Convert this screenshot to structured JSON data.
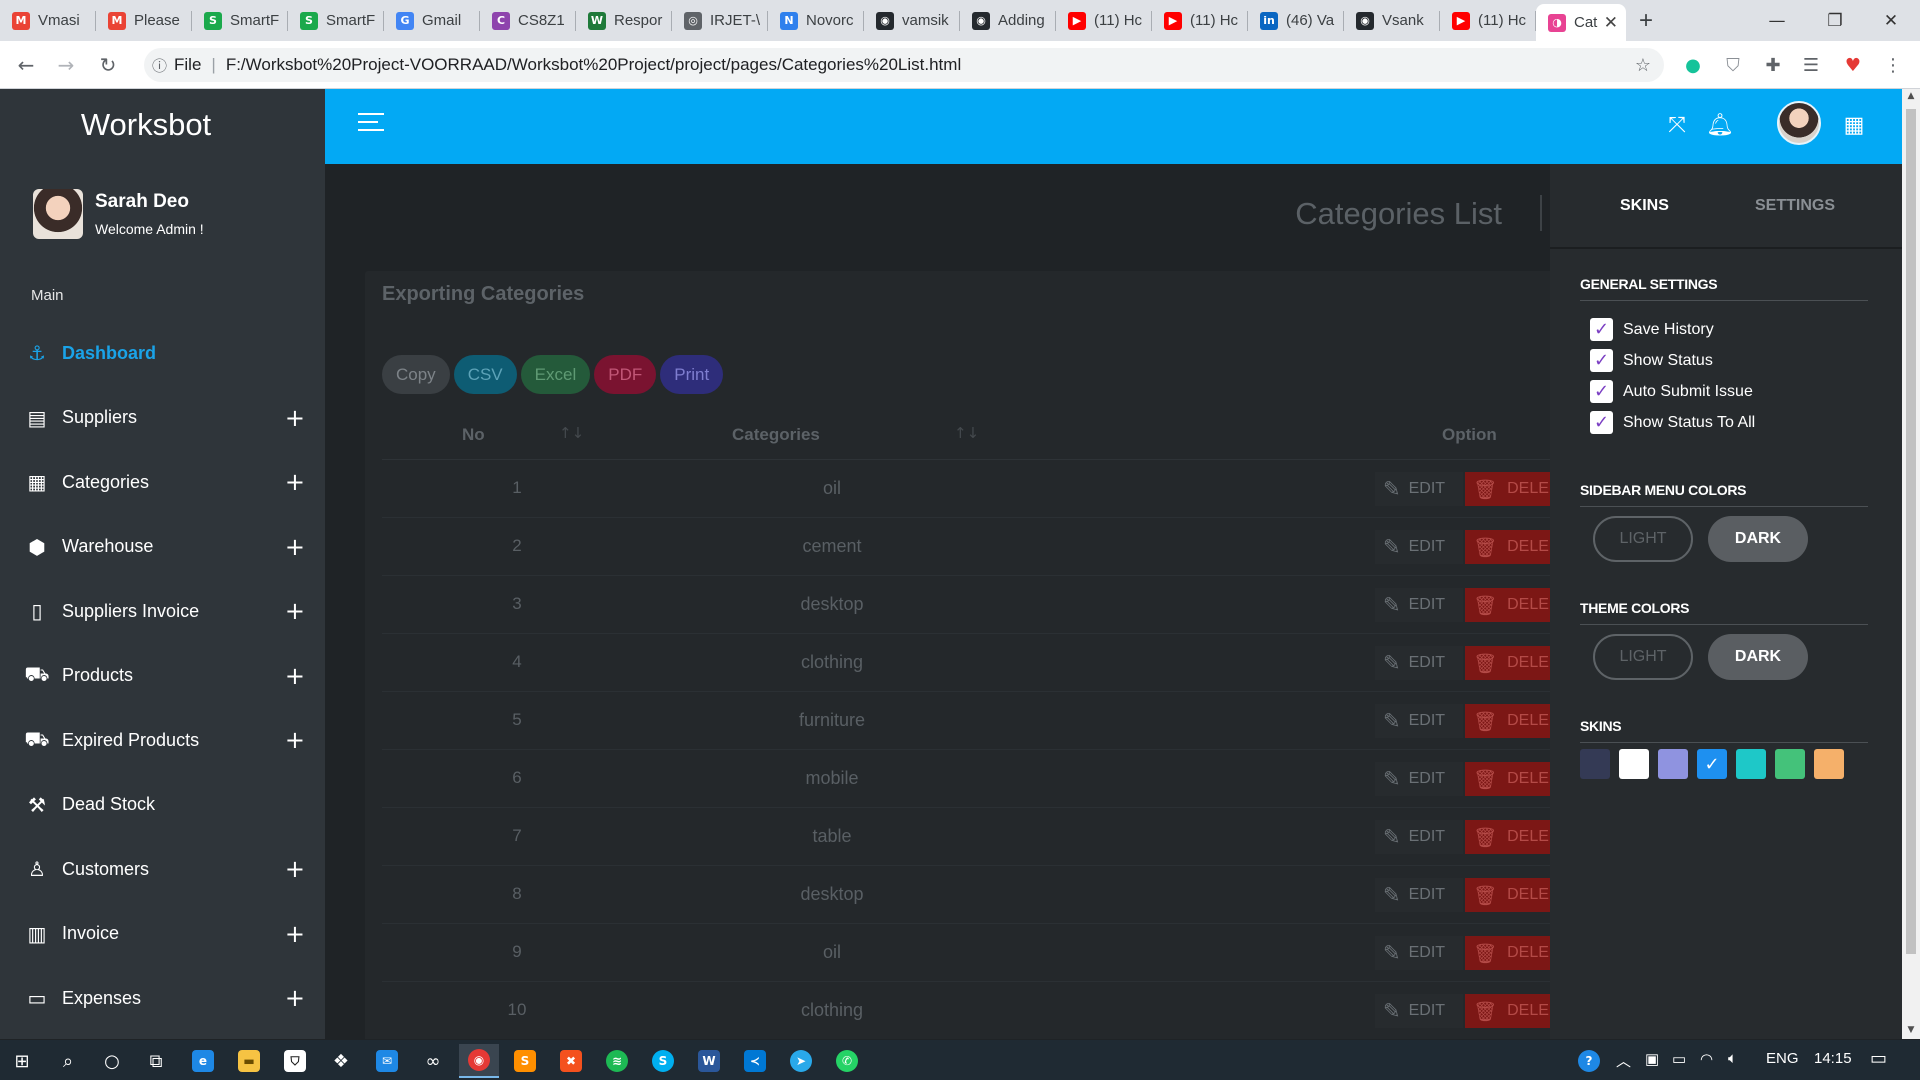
{
  "browser": {
    "tabs": [
      {
        "label": "Vmasi",
        "icon": "gmail-icon",
        "color": "#ea4335",
        "glyph": "M"
      },
      {
        "label": "Please",
        "icon": "gmail-icon",
        "color": "#ea4335",
        "glyph": "M"
      },
      {
        "label": "SmartF",
        "icon": "smart-icon",
        "color": "#1ba94c",
        "glyph": "S"
      },
      {
        "label": "SmartF",
        "icon": "smart-icon",
        "color": "#1ba94c",
        "glyph": "S"
      },
      {
        "label": "Gmail",
        "icon": "google-icon",
        "color": "#4285f4",
        "glyph": "G"
      },
      {
        "label": "CS8Z1",
        "icon": "classroom-icon",
        "color": "#8e44ad",
        "glyph": "C"
      },
      {
        "label": "Respor",
        "icon": "web-icon",
        "color": "#1f7a3a",
        "glyph": "W"
      },
      {
        "label": "IRJET-\\",
        "icon": "globe-icon",
        "color": "#5f6368",
        "glyph": "◎"
      },
      {
        "label": "Novorc",
        "icon": "n-icon",
        "color": "#2f80ed",
        "glyph": "N"
      },
      {
        "label": "vamsik",
        "icon": "github-icon",
        "color": "#24292e",
        "glyph": "◉"
      },
      {
        "label": "Adding",
        "icon": "github-icon",
        "color": "#24292e",
        "glyph": "◉"
      },
      {
        "label": "(11) Hc",
        "icon": "youtube-icon",
        "color": "#ff0000",
        "glyph": "▶"
      },
      {
        "label": "(11) Hc",
        "icon": "youtube-icon",
        "color": "#ff0000",
        "glyph": "▶"
      },
      {
        "label": "(46) Va",
        "icon": "linkedin-icon",
        "color": "#0a66c2",
        "glyph": "in"
      },
      {
        "label": "Vsank",
        "icon": "github-icon",
        "color": "#24292e",
        "glyph": "◉"
      },
      {
        "label": "(11) Hc",
        "icon": "youtube-icon",
        "color": "#ff0000",
        "glyph": "▶"
      },
      {
        "label": "Cat",
        "icon": "page-icon",
        "color": "#e84393",
        "glyph": "◑",
        "active": true
      }
    ],
    "new_tab": "+",
    "url_scheme": "File",
    "url": "F:/Worksbot%20Project-VOORRAAD/Worksbot%20Project/project/pages/Categories%20List.html"
  },
  "app": {
    "brand": "Worksbot",
    "user": {
      "name": "Sarah Deo",
      "role": "Welcome Admin !"
    },
    "menu_heading": "Main",
    "menu": [
      {
        "label": "Dashboard",
        "icon": "anchor-icon",
        "glyph": "⚓",
        "active": true,
        "expandable": false
      },
      {
        "label": "Suppliers",
        "icon": "id-card-icon",
        "glyph": "▤",
        "expandable": true
      },
      {
        "label": "Categories",
        "icon": "grid-icon",
        "glyph": "▦",
        "expandable": true
      },
      {
        "label": "Warehouse",
        "icon": "box-icon",
        "glyph": "⬢",
        "expandable": true
      },
      {
        "label": "Suppliers Invoice",
        "icon": "document-icon",
        "glyph": "▯",
        "expandable": true
      },
      {
        "label": "Products",
        "icon": "cart-icon",
        "glyph": "⛟",
        "expandable": true
      },
      {
        "label": "Expired Products",
        "icon": "cart-icon",
        "glyph": "⛟",
        "expandable": true
      },
      {
        "label": "Dead Stock",
        "icon": "dolly-icon",
        "glyph": "⚒",
        "expandable": false
      },
      {
        "label": "Customers",
        "icon": "user-icon",
        "glyph": "♙",
        "expandable": true
      },
      {
        "label": "Invoice",
        "icon": "receipt-icon",
        "glyph": "▥",
        "expandable": true
      },
      {
        "label": "Expenses",
        "icon": "card-icon",
        "glyph": "▭",
        "expandable": true
      }
    ],
    "page_title": "Categories List",
    "card_title": "Exporting Categories",
    "export_buttons": [
      {
        "label": "Copy",
        "bg": "#3a3f43",
        "fg": "#7d8388"
      },
      {
        "label": "CSV",
        "bg": "#0e5c73",
        "fg": "#5da3b8"
      },
      {
        "label": "Excel",
        "bg": "#245a3a",
        "fg": "#5f9a74"
      },
      {
        "label": "PDF",
        "bg": "#7a1330",
        "fg": "#c25777"
      },
      {
        "label": "Print",
        "bg": "#2e2d7a",
        "fg": "#7f7ed0"
      }
    ],
    "table": {
      "headers": {
        "no": "No",
        "category": "Categories",
        "option": "Option"
      },
      "rows": [
        {
          "no": "1",
          "category": "oil"
        },
        {
          "no": "2",
          "category": "cement"
        },
        {
          "no": "3",
          "category": "desktop"
        },
        {
          "no": "4",
          "category": "clothing"
        },
        {
          "no": "5",
          "category": "furniture"
        },
        {
          "no": "6",
          "category": "mobile"
        },
        {
          "no": "7",
          "category": "table"
        },
        {
          "no": "8",
          "category": "desktop"
        },
        {
          "no": "9",
          "category": "oil"
        },
        {
          "no": "10",
          "category": "clothing"
        }
      ],
      "edit_label": "EDIT",
      "delete_label": "DELE"
    }
  },
  "panel": {
    "tabs": {
      "skins": "SKINS",
      "settings": "SETTINGS"
    },
    "general_title": "GENERAL SETTINGS",
    "general_items": [
      {
        "label": "Save History",
        "checked": true
      },
      {
        "label": "Show Status",
        "checked": true
      },
      {
        "label": "Auto Submit Issue",
        "checked": true
      },
      {
        "label": "Show Status To All",
        "checked": true
      }
    ],
    "sidebar_colors_title": "SIDEBAR MENU COLORS",
    "theme_colors_title": "THEME COLORS",
    "light_label": "LIGHT",
    "dark_label": "DARK",
    "skins_title": "SKINS",
    "skins": [
      "#343a55",
      "#ffffff",
      "#8f93e0",
      "#1e90f0",
      "#1ec8c8",
      "#44c27a",
      "#f5b06a"
    ],
    "selected_skin": 3
  },
  "taskbar": {
    "language": "ENG",
    "time": "14:15"
  }
}
